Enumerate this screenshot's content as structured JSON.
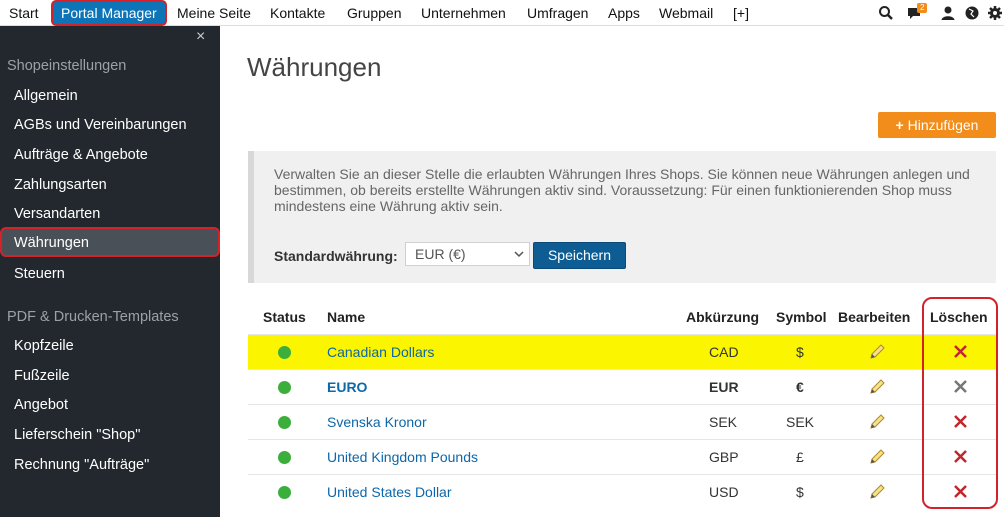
{
  "nav": {
    "items": [
      "Start",
      "Portal Manager",
      "Meine Seite",
      "Kontakte",
      "Gruppen",
      "Unternehmen",
      "Umfragen",
      "Apps",
      "Webmail",
      "[+]"
    ],
    "badge_count": "2",
    "icons": [
      "search-icon",
      "chat-icon",
      "user-icon",
      "globe-icon",
      "gear-icon"
    ]
  },
  "sidebar": {
    "close": "×",
    "section1": "Shopeinstellungen",
    "items1": [
      "Allgemein",
      "AGBs und Vereinbarungen",
      "Aufträge & Angebote",
      "Zahlungsarten",
      "Versandarten",
      "Währungen",
      "Steuern"
    ],
    "section2": "PDF & Drucken-Templates",
    "items2": [
      "Kopfzeile",
      "Fußzeile",
      "Angebot",
      "Lieferschein \"Shop\"",
      "Rechnung \"Aufträge\""
    ]
  },
  "main": {
    "title": "Währungen",
    "add_button": "Hinzufügen",
    "info_text": "Verwalten Sie an dieser Stelle die erlaubten Währungen Ihres Shops. Sie können neue Währungen anlegen und bestimmen, ob bereits erstellte Währungen aktiv sind. Voraussetzung: Für einen funktionierenden Shop muss mindestens eine Währung aktiv sein.",
    "std_label": "Standardwährung:",
    "std_value": "EUR (€)",
    "save_button": "Speichern"
  },
  "table": {
    "headers": [
      "Status",
      "Name",
      "Abkürzung",
      "Symbol",
      "Bearbeiten",
      "Löschen"
    ],
    "rows": [
      {
        "name": "Canadian Dollars",
        "abbr": "CAD",
        "symbol": "$"
      },
      {
        "name": "EURO",
        "abbr": "EUR",
        "symbol": "€"
      },
      {
        "name": "Svenska Kronor",
        "abbr": "SEK",
        "symbol": "SEK"
      },
      {
        "name": "United Kingdom Pounds",
        "abbr": "GBP",
        "symbol": "£"
      },
      {
        "name": "United States Dollar",
        "abbr": "USD",
        "symbol": "$"
      }
    ]
  },
  "colors": {
    "accent": "#0d74b8",
    "highlight": "#fcf500",
    "orange": "#f28c1b",
    "annotation": "#d2232a"
  }
}
